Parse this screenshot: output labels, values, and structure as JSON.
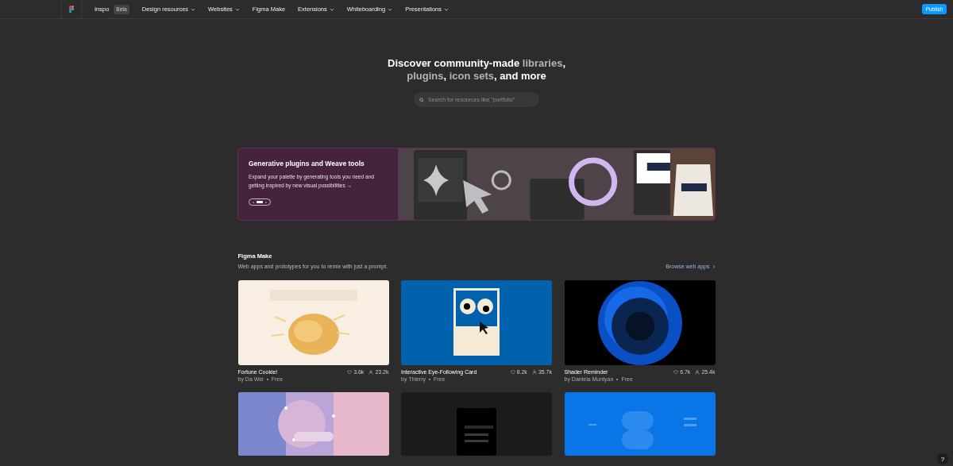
{
  "nav": {
    "items": [
      {
        "label": "Inspo",
        "badge": "Beta",
        "has_menu": false
      },
      {
        "label": "Design resources",
        "has_menu": true
      },
      {
        "label": "Websites",
        "has_menu": true
      },
      {
        "label": "Figma Make",
        "has_menu": false
      },
      {
        "label": "Extensions",
        "has_menu": true
      },
      {
        "label": "Whiteboarding",
        "has_menu": true
      },
      {
        "label": "Presentations",
        "has_menu": true
      }
    ],
    "publish": "Publish"
  },
  "hero": {
    "title": [
      {
        "text": "Discover community-made ",
        "muted": false
      },
      {
        "text": "libraries",
        "muted": true
      },
      {
        "text": ", ",
        "muted": false
      },
      {
        "text": "plugins",
        "muted": true
      },
      {
        "text": ", ",
        "muted": false
      },
      {
        "text": "icon sets",
        "muted": true
      },
      {
        "text": ", and more",
        "muted": false
      }
    ],
    "search": {
      "placeholder": "Search for resources like \"portfolio\""
    }
  },
  "banner": {
    "title": "Generative plugins and Weave tools",
    "text": "Expand your palette by generating tools you need and getting inspired by new visual possibilities →",
    "pager": [
      {
        "selected": false
      },
      {
        "selected": true
      },
      {
        "selected": false
      }
    ]
  },
  "section": {
    "title": "Figma Make",
    "subtitle": "Web apps and prototypes for you to remix with just a prompt.",
    "link": "Browse web apps",
    "cards": [
      {
        "kind": "app",
        "title": "Fortune Cookie!",
        "author": "by Da Wei",
        "price": "Free",
        "likes": "3.6k",
        "users": "23.2k"
      },
      {
        "kind": "app",
        "title": "Interactive Eye-Following Card",
        "author": "by Thierry",
        "price": "Free",
        "likes": "8.2k",
        "users": "35.7k"
      },
      {
        "kind": "app",
        "title": "Shader Reminder",
        "author": "by Daniela Muntyan",
        "price": "Free",
        "likes": "6.7k",
        "users": "25.4k"
      },
      {
        "kind": "picture"
      },
      {
        "kind": "picture"
      },
      {
        "kind": "picture"
      }
    ]
  },
  "help": "?"
}
